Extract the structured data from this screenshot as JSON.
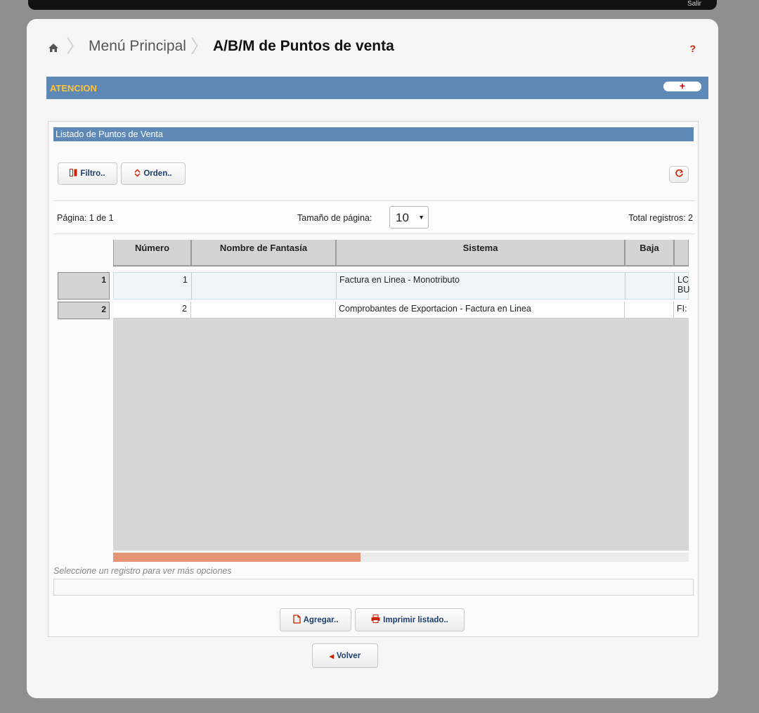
{
  "topbar": {
    "text": "Salir"
  },
  "breadcrumb": {
    "home_icon": "home-icon",
    "menu_label": "Menú Principal",
    "current_label": "A/B/M de Puntos de venta"
  },
  "help": {
    "label": "?"
  },
  "attention": {
    "title": "ATENCION",
    "toggle_label": "+"
  },
  "panel": {
    "title": "Listado de Puntos de Venta",
    "filter_label": "Filtro..",
    "order_label": "Orden..",
    "refresh_icon": "refresh-icon"
  },
  "pager": {
    "page_text": "Página: 1 de 1",
    "page_size_label": "Tamaño de página:",
    "page_size_value": "10",
    "total_text": "Total registros: 2"
  },
  "grid": {
    "columns": [
      "Número",
      "Nombre de Fantasía",
      "Sistema",
      "Baja",
      ""
    ],
    "rows": [
      {
        "index": "1",
        "numero": "1",
        "fantasia": "",
        "sistema": "Factura en Linea - Monotributo",
        "baja": "",
        "extra_line1": "LC",
        "extra_line2": "BU"
      },
      {
        "index": "2",
        "numero": "2",
        "fantasia": "",
        "sistema": "Comprobantes de Exportacion - Factura en Linea",
        "baja": "",
        "extra_line1": "FI:",
        "extra_line2": ""
      }
    ],
    "scroll_fraction": 0.43
  },
  "hint_text": "Seleccione un registro para ver más opciones",
  "actions": {
    "add_label": "Agregar..",
    "print_label": "Imprimir listado..",
    "back_label": "Volver"
  },
  "colors": {
    "header_blue": "#5e88b6",
    "attention_text": "#ffc439",
    "accent_red": "#cc2200",
    "scroll_thumb": "#e59575"
  }
}
